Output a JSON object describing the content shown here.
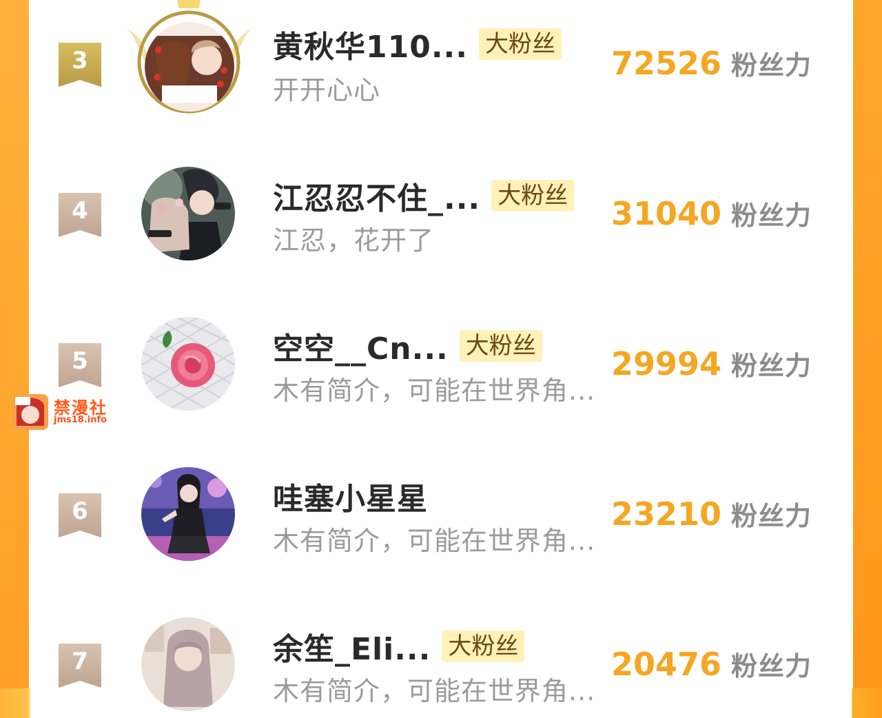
{
  "badge_label": "大粉丝",
  "score_unit": "粉丝力",
  "colors": {
    "accent": "#f5a623",
    "gold_ribbon": "#c8a64a",
    "rank_ribbon": "#c9ae9a",
    "badge_bg": "#fff1b8"
  },
  "entries": [
    {
      "rank": "3",
      "name": "黄秋华110...",
      "badge": "大粉丝",
      "desc": "开开心心",
      "score": "72526",
      "unit": "粉丝力"
    },
    {
      "rank": "4",
      "name": "江忍忍不住_...",
      "badge": "大粉丝",
      "desc": "江忍，花开了",
      "score": "31040",
      "unit": "粉丝力"
    },
    {
      "rank": "5",
      "name": "空空__Cn...",
      "badge": "大粉丝",
      "desc": "木有简介，可能在世界角...",
      "score": "29994",
      "unit": "粉丝力"
    },
    {
      "rank": "6",
      "name": "哇塞小星星",
      "badge": "",
      "desc": "木有简介，可能在世界角...",
      "score": "23210",
      "unit": "粉丝力"
    },
    {
      "rank": "7",
      "name": "余笙_Eli...",
      "badge": "大粉丝",
      "desc": "木有简介，可能在世界角...",
      "score": "20476",
      "unit": "粉丝力"
    }
  ],
  "watermark": {
    "title": "禁漫社",
    "subtitle": "jms18.info"
  }
}
